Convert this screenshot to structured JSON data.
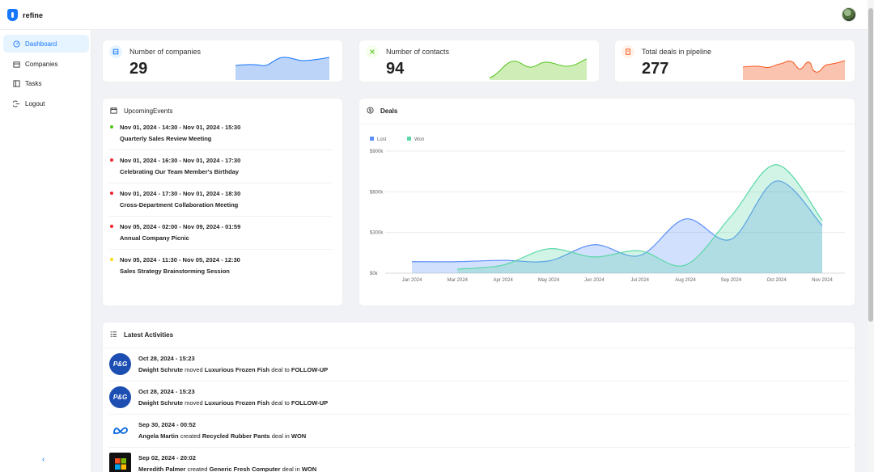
{
  "app": {
    "name": "refine"
  },
  "sidebar": {
    "items": [
      {
        "label": "Dashboard",
        "icon": "dashboard-icon",
        "active": true
      },
      {
        "label": "Companies",
        "icon": "shop-icon"
      },
      {
        "label": "Tasks",
        "icon": "project-icon"
      },
      {
        "label": "Logout",
        "icon": "logout-icon"
      }
    ],
    "collapse_icon": "chevron-left-icon"
  },
  "stats": [
    {
      "title": "Number of companies",
      "value": "29",
      "color": "#1677ff",
      "fill": "#bcd4f7",
      "icon": "company-icon"
    },
    {
      "title": "Number of contacts",
      "value": "94",
      "color": "#52c41a",
      "fill": "#cfeeb7",
      "icon": "contacts-icon"
    },
    {
      "title": "Total deals in pipeline",
      "value": "277",
      "color": "#fa541c",
      "fill": "#f9c3b0",
      "icon": "audit-icon"
    }
  ],
  "events": {
    "title": "UpcomingEvents",
    "items": [
      {
        "date": "Nov 01, 2024 - 14:30 - Nov 01, 2024 - 15:30",
        "title": "Quarterly Sales Review Meeting",
        "color": "#52c41a"
      },
      {
        "date": "Nov 01, 2024 - 16:30 - Nov 01, 2024 - 17:30",
        "title": "Celebrating Our Team Member's Birthday",
        "color": "#f5222d"
      },
      {
        "date": "Nov 01, 2024 - 17:30 - Nov 01, 2024 - 18:30",
        "title": "Cross-Department Collaboration Meeting",
        "color": "#f5222d"
      },
      {
        "date": "Nov 05, 2024 - 02:00 - Nov 09, 2024 - 01:59",
        "title": "Annual Company Picnic",
        "color": "#f5222d"
      },
      {
        "date": "Nov 05, 2024 - 11:30 - Nov 05, 2024 - 12:30",
        "title": "Sales Strategy Brainstorming Session",
        "color": "#fadb14"
      }
    ]
  },
  "deals": {
    "title": "Deals",
    "legend": [
      {
        "label": "Lost",
        "color": "#5b8ff9"
      },
      {
        "label": "Won",
        "color": "#5ad8a6"
      }
    ]
  },
  "chart_data": {
    "type": "area",
    "title": "Deals",
    "categories": [
      "Jan 2024",
      "Mar 2024",
      "Apr 2024",
      "May 2024",
      "Jun 2024",
      "Jul 2024",
      "Aug 2024",
      "Sep 2024",
      "Oct 2024",
      "Nov 2024"
    ],
    "y_ticks": [
      "$0k",
      "$300k",
      "$600k",
      "$900k"
    ],
    "ylim": [
      0,
      900
    ],
    "legend_position": "top-left",
    "grid": true,
    "series": [
      {
        "name": "Lost",
        "color": "#5b8ff9",
        "x": [
          0,
          1,
          2,
          3,
          4,
          5,
          6,
          7,
          8,
          9
        ],
        "values": [
          85,
          85,
          95,
          90,
          210,
          130,
          400,
          250,
          680,
          350
        ]
      },
      {
        "name": "Won",
        "color": "#5ad8a6",
        "x": [
          1,
          2,
          3,
          4,
          5,
          6,
          7,
          8,
          9
        ],
        "values": [
          30,
          60,
          180,
          120,
          165,
          60,
          420,
          800,
          390
        ]
      }
    ]
  },
  "activities": {
    "title": "Latest Activities",
    "items": [
      {
        "time": "Oct 28, 2024 - 15:23",
        "user": "Dwight Schrute",
        "verb": "moved",
        "deal": "Luxurious Frozen Fish",
        "mid": "deal to",
        "stage": "FOLLOW-UP",
        "logo": "P&G",
        "logo_bg": "#1d4fb2"
      },
      {
        "time": "Oct 28, 2024 - 15:23",
        "user": "Dwight Schrute",
        "verb": "moved",
        "deal": "Luxurious Frozen Fish",
        "mid": "deal to",
        "stage": "FOLLOW-UP",
        "logo": "P&G",
        "logo_bg": "#1d4fb2"
      },
      {
        "time": "Sep 30, 2024 - 00:52",
        "user": "Angela Martin",
        "verb": "created",
        "deal": "Recycled Rubber Pants",
        "mid": "deal in",
        "stage": "WON",
        "logo": "meta-logo-icon",
        "logo_bg": "#ffffff"
      },
      {
        "time": "Sep 02, 2024 - 20:02",
        "user": "Meredith Palmer",
        "verb": "created",
        "deal": "Generic Fresh Computer",
        "mid": "deal in",
        "stage": "WON",
        "logo": "microsoft-logo-icon",
        "logo_bg": "#111111"
      }
    ]
  }
}
